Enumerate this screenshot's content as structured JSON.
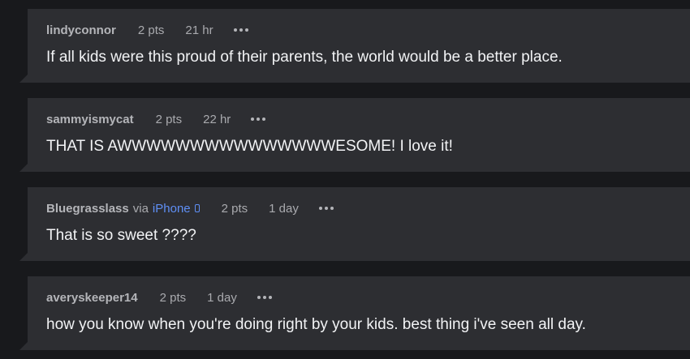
{
  "comments": [
    {
      "username": "lindyconnor",
      "points": "2 pts",
      "age": "21 hr",
      "more_icon": "more-dots-icon",
      "text": "If all kids were this proud of their parents, the world would be a better place."
    },
    {
      "username": "sammyismycat",
      "points": "2 pts",
      "age": "22 hr",
      "more_icon": "more-dots-icon",
      "text": "THAT IS AWWWWWWWWWWWWWWWESOME! I love it!"
    },
    {
      "username": "Bluegrasslass",
      "via": "via",
      "device": "iPhone",
      "device_icon": "phone-icon",
      "points": "2 pts",
      "age": "1 day",
      "more_icon": "more-dots-icon",
      "text": "That is so sweet ????"
    },
    {
      "username": "averyskeeper14",
      "points": "2 pts",
      "age": "1 day",
      "more_icon": "more-dots-icon",
      "text": "how you know when you're doing right by your kids. best thing i've seen all day."
    }
  ],
  "colors": {
    "background": "#18191c",
    "card": "#2d2e32",
    "link_accent": "#5f8ff5",
    "text": "#f2f3f5",
    "meta": "#a9aaae"
  }
}
